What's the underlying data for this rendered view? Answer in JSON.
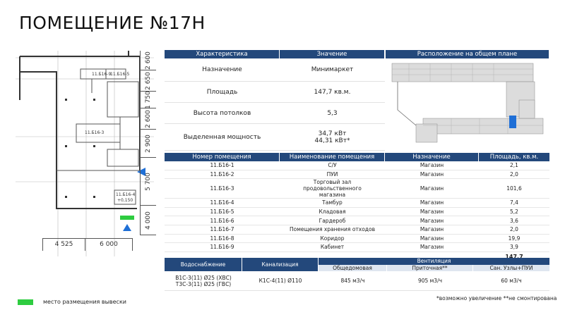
{
  "title": "ПОМЕЩЕНИЕ №17Н",
  "plan": {
    "room_labels": [
      "11.Б16-9",
      "11.Б16-5",
      "11.Б16-3",
      "11.Б16-4",
      "+0,150"
    ],
    "dims_vertical": [
      "2 600",
      "2 650",
      "1 750",
      "2 600",
      "2 900",
      "5 700",
      "4 000"
    ],
    "dims_horizontal": [
      "4 525",
      "6 000"
    ],
    "colors": {
      "sign_marker": "#2ecc40",
      "entrance_arrow": "#1f6fd6",
      "wall": "#333333"
    }
  },
  "characteristics": {
    "headers": [
      "Характеристика",
      "Значение",
      "Расположение на общем плане"
    ],
    "rows": [
      {
        "label": "Назначение",
        "value": "Минимаркет"
      },
      {
        "label": "Площадь",
        "value": "147,7 кв.м."
      },
      {
        "label": "Высота потолков",
        "value": "5,3"
      },
      {
        "label": "Выделенная мощность",
        "value": "34,7 кВт",
        "value2": "44,31 кВт*"
      }
    ]
  },
  "rooms": {
    "headers": [
      "Номер помещения",
      "Наименование помещения",
      "Назначение",
      "Площадь, кв.м."
    ],
    "rows": [
      [
        "11.Б16-1",
        "С/У",
        "Магазин",
        "2,1"
      ],
      [
        "11.Б16-2",
        "ПУИ",
        "Магазин",
        "2,0"
      ],
      [
        "11.Б16-3",
        "Торговый зал продовольственного магазина",
        "Магазин",
        "101,6"
      ],
      [
        "11.Б16-4",
        "Тамбур",
        "Магазин",
        "7,4"
      ],
      [
        "11.Б16-5",
        "Кладовая",
        "Магазин",
        "5,2"
      ],
      [
        "11.Б16-6",
        "Гардероб",
        "Магазин",
        "3,6"
      ],
      [
        "11.Б16-7",
        "Помещения хранения отходов",
        "Магазин",
        "2,0"
      ],
      [
        "11.Б16-8",
        "Коридор",
        "Магазин",
        "19,9"
      ],
      [
        "11.Б16-9",
        "Кабинет",
        "Магазин",
        "3,9"
      ]
    ],
    "total": "147,7"
  },
  "utilities": {
    "headers": [
      "Водоснабжение",
      "Канализация",
      "Вентиляция"
    ],
    "vent_sub": [
      "Общедомовая",
      "Приточная**",
      "Сан. Узлы+ПУИ"
    ],
    "water_1": "В1С-3(11) Ø25 (ХВС)",
    "water_2": "Т3С-3(11) Ø25 (ГВС)",
    "sewer": "К1С-4(11) Ø110",
    "vent_values": [
      "845 м3/ч",
      "905 м3/ч",
      "60 м3/ч"
    ]
  },
  "notes": "*возможно увеличение    **не смонтирована",
  "legend": {
    "label": "место размещения вывески"
  }
}
